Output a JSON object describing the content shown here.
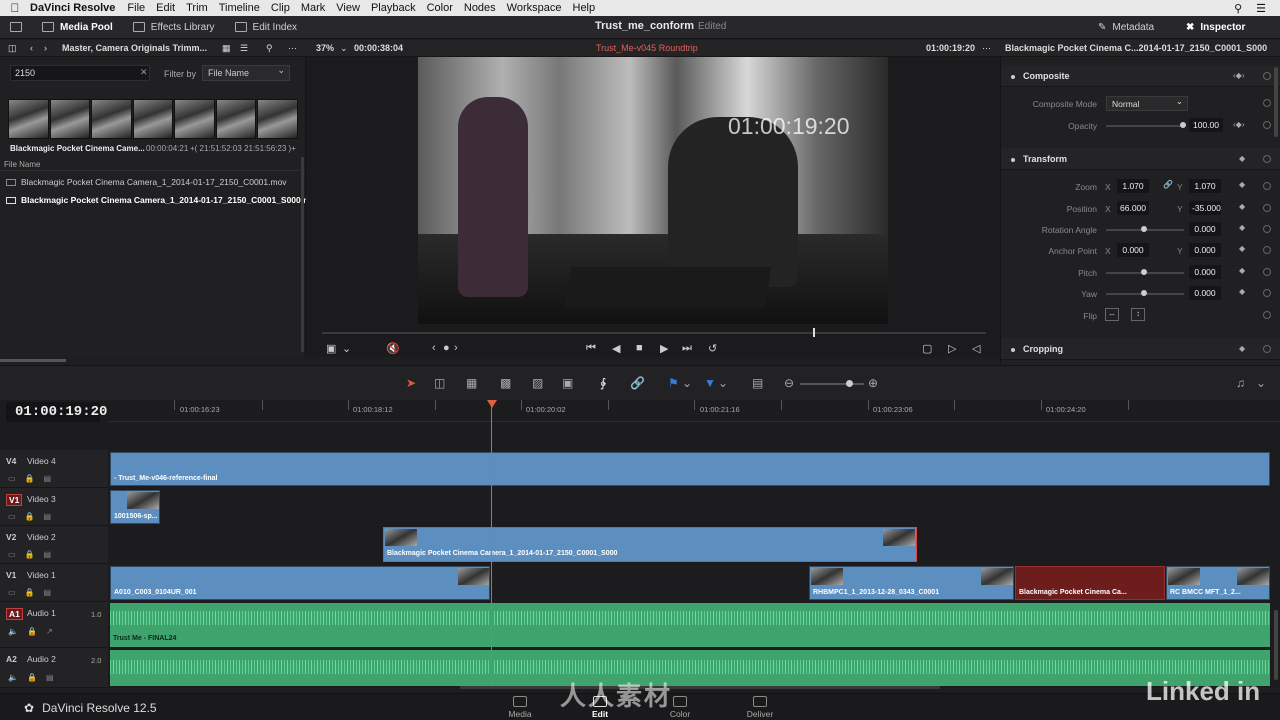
{
  "menubar": {
    "apple": "",
    "app_name": "DaVinci Resolve",
    "items": [
      "File",
      "Edit",
      "Trim",
      "Timeline",
      "Clip",
      "Mark",
      "View",
      "Playback",
      "Color",
      "Nodes",
      "Workspace",
      "Help"
    ]
  },
  "topbar": {
    "media_pool": "Media Pool",
    "effects_library": "Effects Library",
    "edit_index": "Edit Index",
    "project_title": "Trust_me_conform",
    "project_status": "Edited",
    "metadata": "Metadata",
    "inspector": "Inspector"
  },
  "bar2": {
    "bin_path": "Master, Camera Originals Trimm...",
    "zoom": "37%",
    "source_tc": "00:00:38:04",
    "timeline_name": "Trust_Me-v045 Roundtrip",
    "record_tc": "01:00:19:20",
    "inspector_clip": "Blackmagic Pocket Cinema C...2014-01-17_2150_C0001_S000"
  },
  "media_pool": {
    "search_value": "2150",
    "filter_label": "Filter by",
    "filter_value": "File Name",
    "clip_name": "Blackmagic Pocket Cinema Came...",
    "clip_duration": "00:00:04:21",
    "clip_tc": "+( 21:51:52:03  21:51:56:23 )+",
    "file_header": "File Name",
    "files": [
      "Blackmagic Pocket Cinema Camera_1_2014-01-17_2150_C0001.mov",
      "Blackmagic Pocket Cinema Camera_1_2014-01-17_2150_C0001_S000.mov"
    ]
  },
  "viewer": {
    "overlay_tc": "01:00:19:20",
    "playhead_fraction": 0.74
  },
  "inspector": {
    "composite": {
      "title": "Composite",
      "mode_label": "Composite Mode",
      "mode_value": "Normal",
      "opacity_label": "Opacity",
      "opacity_value": "100.00"
    },
    "transform": {
      "title": "Transform",
      "zoom_label": "Zoom",
      "zoom_x": "1.070",
      "zoom_y": "1.070",
      "position_label": "Position",
      "position_x": "66.000",
      "position_y": "-35.000",
      "rotation_label": "Rotation Angle",
      "rotation_value": "0.000",
      "anchor_label": "Anchor Point",
      "anchor_x": "0.000",
      "anchor_y": "0.000",
      "pitch_label": "Pitch",
      "pitch_value": "0.000",
      "yaw_label": "Yaw",
      "yaw_value": "0.000",
      "flip_label": "Flip",
      "x": "X",
      "y": "Y"
    },
    "cropping": {
      "title": "Cropping"
    }
  },
  "timeline": {
    "timecode": "01:00:19:20",
    "ruler": [
      "01:00:16:23",
      "01:00:18:12",
      "01:00:20:02",
      "01:00:21:16",
      "01:00:23:06",
      "01:00:24:20"
    ],
    "tracks": {
      "v4": {
        "id": "V4",
        "name": "Video 4"
      },
      "v3": {
        "id": "V1",
        "name": "Video 3"
      },
      "v2": {
        "id": "V2",
        "name": "Video 2"
      },
      "v1": {
        "id": "V1",
        "name": "Video 1"
      },
      "a1": {
        "id": "A1",
        "name": "Audio 1",
        "level": "1.0"
      },
      "a2": {
        "id": "A2",
        "name": "Audio 2",
        "level": "2.0"
      }
    },
    "clips": {
      "v4_ref": "- Trust_Me-v046-reference-final",
      "v3_clip": "1001506-sp...",
      "v2_clip": "Blackmagic Pocket Cinema Camera_1_2014-01-17_2150_C0001_S000",
      "v1_a": "A010_C003_0104UR_001",
      "v1_b": "RHBMPC1_1_2013-12-28_0343_C0001",
      "v1_c": "Blackmagic Pocket Cinema Ca...",
      "v1_d": "RC BMCC MFT_1_2...",
      "a1_clip": "Trust Me - FINAL24"
    }
  },
  "bottombar": {
    "brand": "DaVinci Resolve 12.5",
    "pages": [
      "Media",
      "Edit",
      "Color",
      "Deliver"
    ],
    "active_page": "Edit",
    "linkedin": "Linked in",
    "watermark": "人人素材"
  },
  "colors": {
    "accent_red": "#e06040",
    "clip_blue": "#5c8fc0",
    "audio_green": "#3ea36c",
    "selected_clip_red": "#6e1d1d"
  }
}
